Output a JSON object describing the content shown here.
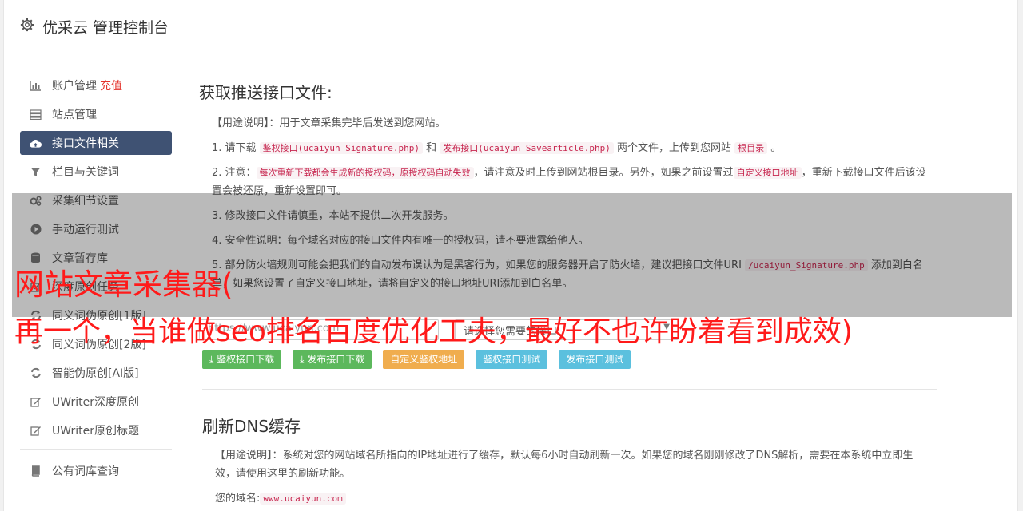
{
  "header": {
    "title": "优采云 管理控制台",
    "icon": "gear-icon"
  },
  "sidebar": {
    "items": [
      {
        "label": "账户管理",
        "extra": "充值",
        "icon": "bar-chart-icon"
      },
      {
        "label": "站点管理",
        "icon": "server-icon"
      },
      {
        "label": "接口文件相关",
        "icon": "cloud-upload-icon",
        "active": true
      },
      {
        "label": "栏目与关键词",
        "icon": "filter-icon"
      },
      {
        "label": "采集细节设置",
        "icon": "gears-icon"
      },
      {
        "label": "手动运行测试",
        "icon": "play-circle-icon"
      },
      {
        "label": "文章暂存库",
        "icon": "database-icon"
      },
      {
        "label": "深度原创任务",
        "icon": "edit-icon"
      },
      {
        "label": "同义词伪原创[1版]",
        "icon": "refresh-icon"
      },
      {
        "label": "同义词伪原创[2版]",
        "icon": "refresh-icon"
      },
      {
        "label": "智能伪原创[AI版]",
        "icon": "refresh-icon"
      },
      {
        "label": "UWriter深度原创",
        "icon": "edit-icon"
      },
      {
        "label": "UWriter原创标题",
        "icon": "edit-icon"
      },
      {
        "label": "公有词库查询",
        "icon": "book-icon"
      }
    ]
  },
  "section1": {
    "title": "获取推送接口文件:",
    "usage": "【用途说明】：用于文章采集完毕后发送到您网站。",
    "p1": {
      "a": "1. 请下载 ",
      "code1": "鉴权接口(ucaiyun_Signature.php)",
      "b": " 和 ",
      "code2": "发布接口(ucaiyun_Savearticle.php)",
      "c": " 两个文件，上传到您网站 ",
      "code3": "根目录",
      "d": " 。"
    },
    "p2": {
      "a": "2. 注意：",
      "code1": "每次重新下载都会生成新的授权码，原授权码自动失效",
      "b": "，请注意及时上传到网站根目录。另外，如果之前设置过",
      "code2": "自定义接口地址",
      "c": "，重新下载接口文件后该设置会被还原，重新设置即可。"
    },
    "p3": "3. 修改接口文件请慎重，本站不提供二次开发服务。",
    "p4": "4. 安全性说明：每个域名对应的接口文件内有唯一的授权码，请不要泄露给他人。",
    "p5": {
      "a": "5. 部分防火墙规则可能会把我们的自动发布误认为是黑客行为，如果您的服务器开启了防火墙，建议把接口文件URI ",
      "code1": "/ucaiyun_Signature.php",
      "b": " 添加到白名单，如果您设置了自定义接口地址，请将自定义的接口地址URI添加到白名单。"
    },
    "url_placeholder": "https://www.ucaiyun.com",
    "select_value": "请选择您需要的接口",
    "buttons": [
      "鉴权接口下载",
      "发布接口下载",
      "自定义鉴权地址",
      "鉴权接口测试",
      "发布接口测试"
    ]
  },
  "section2": {
    "title": "刷新DNS缓存",
    "usage": "【用途说明】：系统对您的网站域名所指向的IP地址进行了缓存，默认每6小时自动刷新一次。如果您的域名刚刚修改了DNS解析，需要在本系统中立即生效，请使用这里的刷新功能。",
    "domain_label": "您的域名:",
    "domain_value": "www.ucaiyun.com"
  },
  "overlay": {
    "line1": "网站文章采集器(",
    "line2": "再一个，当谁做seo排名百度优化工夫，最好不也许盼着看到成效)"
  },
  "colors": {
    "active_nav": "#3f5273",
    "green": "#5cb85c",
    "orange": "#f0ad4e",
    "blue": "#5bc0de",
    "overlay_text": "#ff1a1a"
  }
}
